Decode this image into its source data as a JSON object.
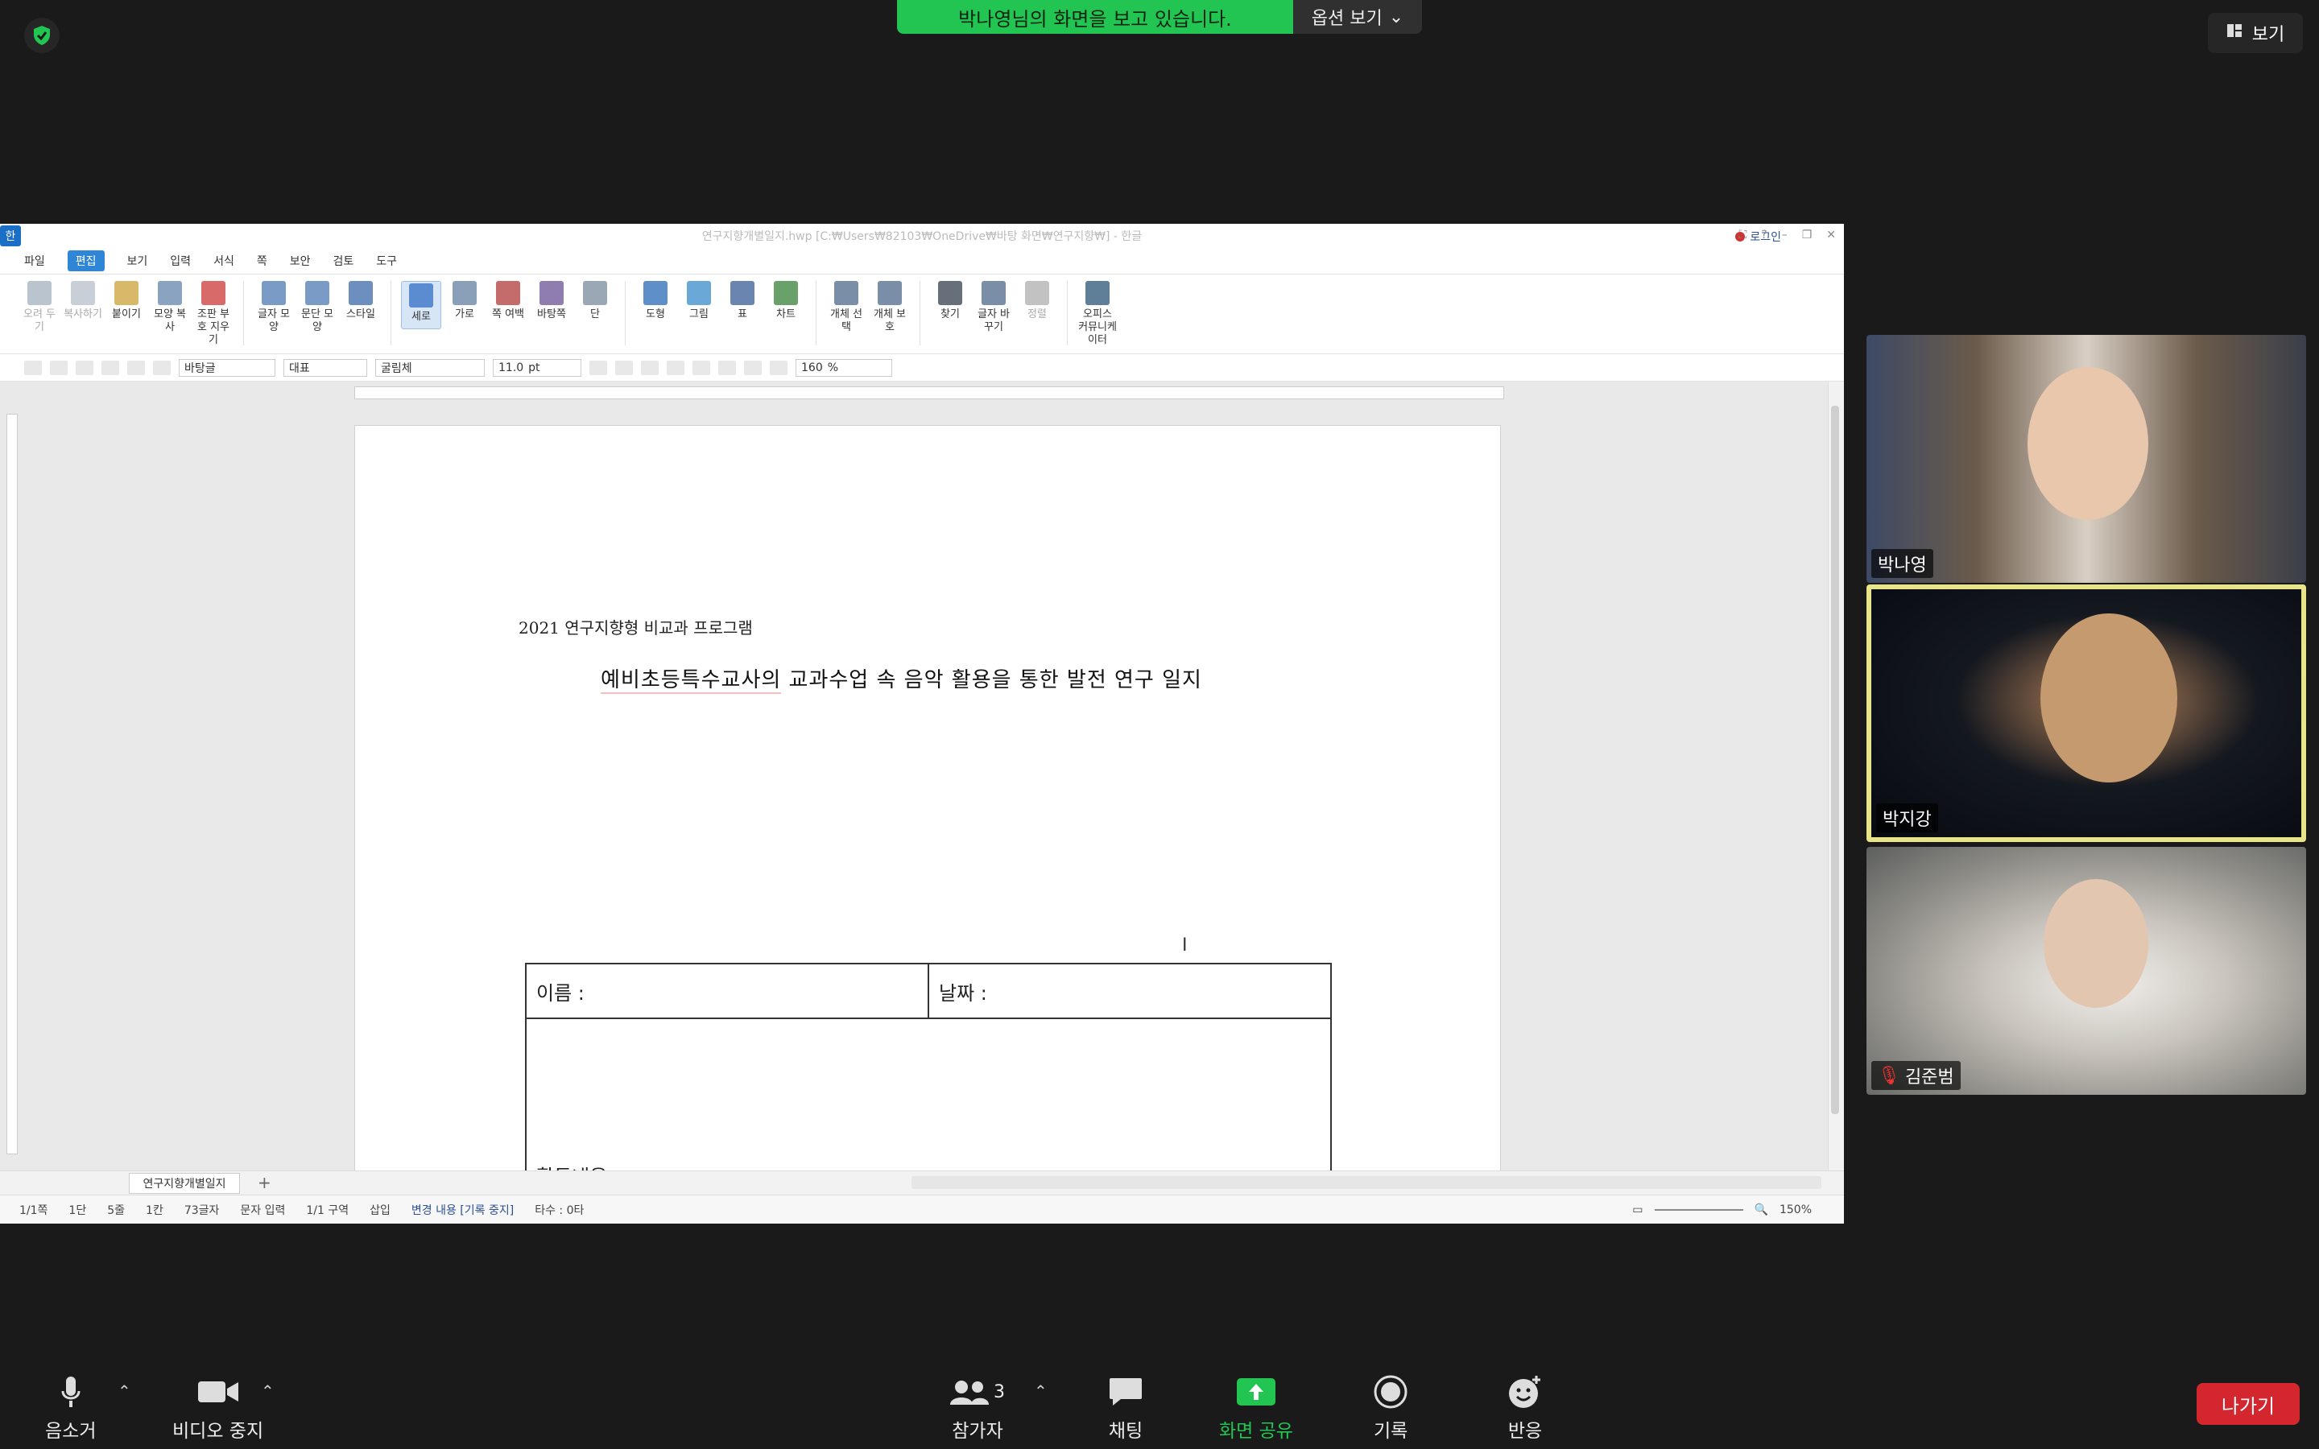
{
  "banner": {
    "text": "박나영님의 화면을 보고 있습니다.",
    "options_label": "옵션 보기",
    "view_label": "보기"
  },
  "colors": {
    "banner_green": "#23c552",
    "leave_red": "#d3262f",
    "active_speaker": "#e8e48a",
    "hwp_accent": "#2f86d6"
  },
  "hwp": {
    "title": "연구지향개별일지.hwp [C:₩Users₩82103₩OneDrive₩바탕 화면₩연구지향₩] - 한글",
    "logo": "한",
    "login": "로그인",
    "menu": [
      {
        "label": "파일"
      },
      {
        "label": "편집"
      },
      {
        "label": "보기"
      },
      {
        "label": "입력"
      },
      {
        "label": "서식"
      },
      {
        "label": "쪽"
      },
      {
        "label": "보안"
      },
      {
        "label": "검토"
      },
      {
        "label": "도구"
      }
    ],
    "ribbon": [
      {
        "label": "오려 두기",
        "icon": "scissors-icon"
      },
      {
        "label": "복사하기",
        "icon": "copy-icon"
      },
      {
        "label": "붙이기",
        "icon": "paste-icon"
      },
      {
        "label": "모양 복사",
        "icon": "format-painter-icon"
      },
      {
        "label": "조판 부호 지우기",
        "icon": "clear-marks-icon"
      },
      {
        "label": "글자 모양",
        "icon": "char-shape-icon"
      },
      {
        "label": "문단 모양",
        "icon": "para-shape-icon"
      },
      {
        "label": "스타일",
        "icon": "style-icon"
      },
      {
        "label": "세로",
        "icon": "portrait-icon"
      },
      {
        "label": "가로",
        "icon": "landscape-icon"
      },
      {
        "label": "쪽 여백",
        "icon": "margin-icon"
      },
      {
        "label": "바탕쪽",
        "icon": "master-page-icon"
      },
      {
        "label": "단",
        "icon": "columns-icon"
      },
      {
        "label": "도형",
        "icon": "shape-icon"
      },
      {
        "label": "그림",
        "icon": "picture-icon"
      },
      {
        "label": "표",
        "icon": "table-icon"
      },
      {
        "label": "차트",
        "icon": "chart-icon"
      },
      {
        "label": "개체 선택",
        "icon": "object-select-icon"
      },
      {
        "label": "개체 보호",
        "icon": "object-lock-icon"
      },
      {
        "label": "찾기",
        "icon": "binoculars-icon"
      },
      {
        "label": "글자 바꾸기",
        "icon": "replace-icon"
      },
      {
        "label": "정렬",
        "icon": "sort-icon"
      },
      {
        "label": "오피스 커뮤니케이터",
        "icon": "communicator-icon"
      }
    ],
    "format": {
      "style": "바탕글",
      "lang": "대표",
      "font": "굴림체",
      "size": "11.0",
      "unit": "pt",
      "zoom_value": "160",
      "zoom_unit": "%"
    },
    "doc": {
      "subtitle": "2021 연구지향형 비교과 프로그램",
      "title_underlined": "예비초등특수교사의",
      "title_rest": " 교과수업 속 음악 활용을 통한 발전 연구 일지",
      "name_label": "이름 :",
      "date_label": "날짜 :",
      "activity_label": "활동내용 :"
    },
    "sheet_tab": "연구지향개별일지",
    "status": [
      "1/1쪽",
      "1단",
      "5줄",
      "1칸",
      "73글자",
      "문자 입력",
      "1/1 구역",
      "삽입"
    ],
    "status_change": "변경 내용 [기록 중지]",
    "status_keys": "타수 : 0타",
    "zoom": "150%"
  },
  "participants": [
    {
      "name": "박나영",
      "muted": false,
      "active": false
    },
    {
      "name": "박지강",
      "muted": false,
      "active": true
    },
    {
      "name": "김준범",
      "muted": true,
      "active": false
    }
  ],
  "toolbar": {
    "mute": "음소거",
    "video": "비디오 중지",
    "participants": "참가자",
    "participants_count": "3",
    "chat": "채팅",
    "share": "화면 공유",
    "record": "기록",
    "reactions": "반응",
    "leave": "나가기"
  }
}
